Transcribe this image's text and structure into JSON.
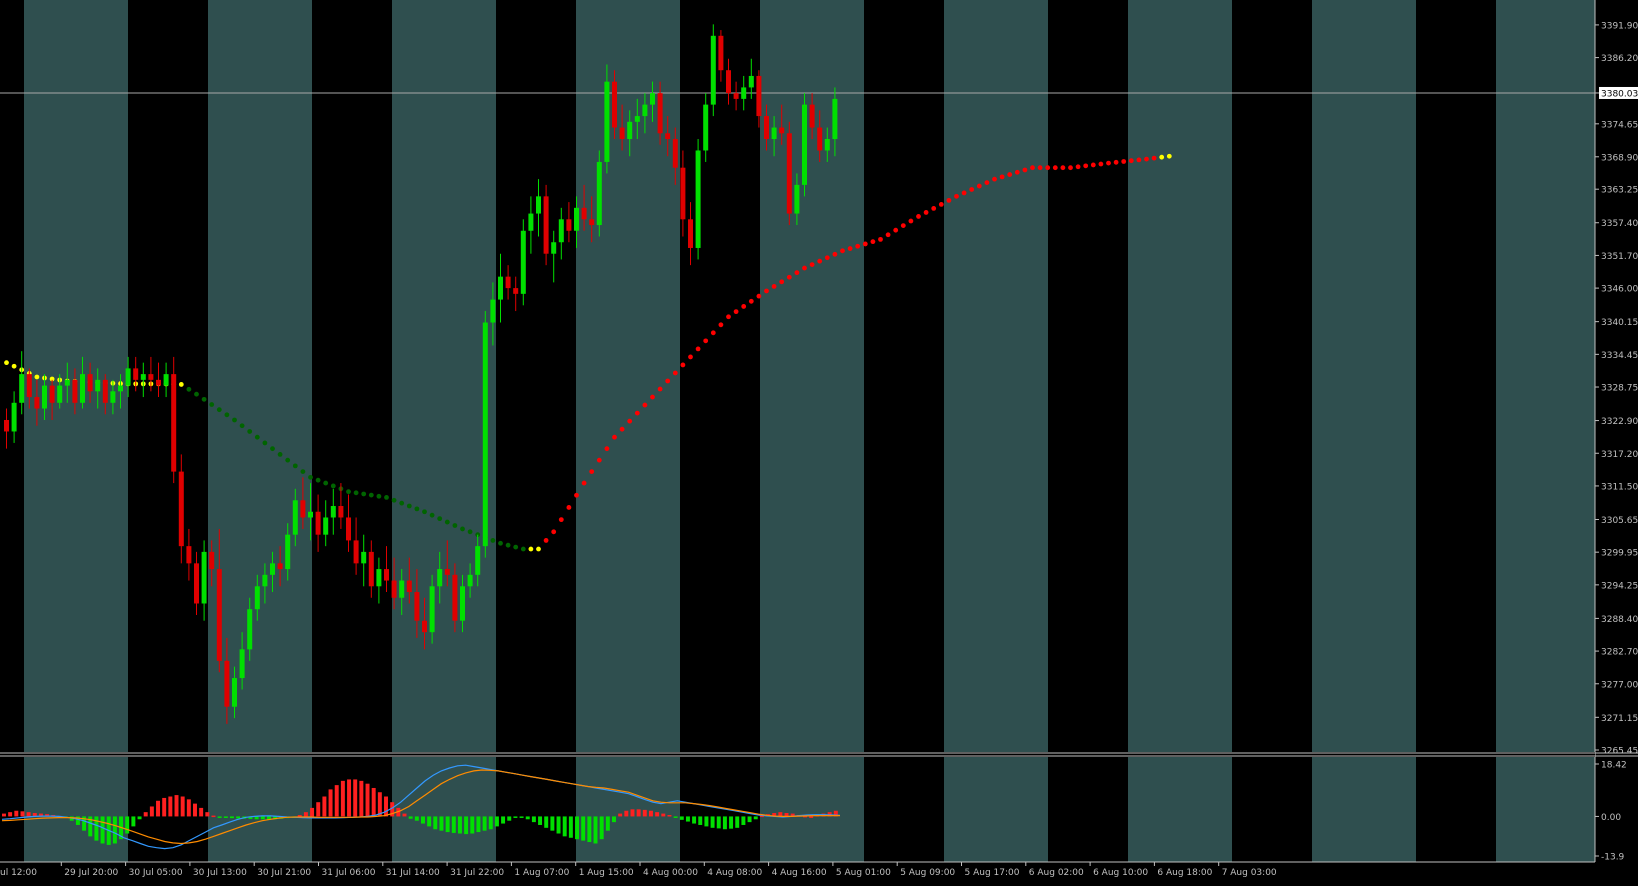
{
  "chart_data": [
    {
      "type": "candlestick",
      "title": "",
      "y_axis_ticks": [
        "3391.90",
        "3386.20",
        "3380.03",
        "3374.65",
        "3368.90",
        "3363.25",
        "3357.40",
        "3351.70",
        "3346.00",
        "3340.15",
        "3334.45",
        "3328.75",
        "3322.90",
        "3317.20",
        "3311.50",
        "3305.65",
        "3299.95",
        "3294.25",
        "3288.40",
        "3282.70",
        "3277.00",
        "3271.15",
        "3265.45"
      ],
      "ylim": [
        3265.45,
        3395.5
      ],
      "current_price": 3380.03,
      "x_axis_labels": [
        "ul 12:00",
        "29 Jul 20:00",
        "30 Jul 05:00",
        "30 Jul 13:00",
        "30 Jul 21:00",
        "31 Jul 06:00",
        "31 Jul 14:00",
        "31 Jul 22:00",
        "1 Aug 07:00",
        "1 Aug 15:00",
        "4 Aug 00:00",
        "4 Aug 08:00",
        "4 Aug 16:00",
        "5 Aug 01:00",
        "5 Aug 09:00",
        "5 Aug 17:00",
        "6 Aug 02:00",
        "6 Aug 10:00",
        "6 Aug 18:00",
        "7 Aug 03:00"
      ],
      "colors": {
        "bull": "#00e000",
        "bear": "#e00000",
        "background_light": "#2f4f4f",
        "background_dark": "#000000",
        "ma_yellow": "#ffff00",
        "ma_green": "#006400",
        "ma_red": "#ff0000"
      },
      "moving_average": [
        {
          "x": 0,
          "y": 3333.0,
          "c": "yellow"
        },
        {
          "x": 4,
          "y": 3330.5,
          "c": "yellow"
        },
        {
          "x": 8,
          "y": 3329.8,
          "c": "yellow"
        },
        {
          "x": 12,
          "y": 3329.5,
          "c": "yellow"
        },
        {
          "x": 16,
          "y": 3329.3,
          "c": "yellow"
        },
        {
          "x": 20,
          "y": 3329.3,
          "c": "yellow"
        },
        {
          "x": 23,
          "y": 3329.2,
          "c": "yellow"
        },
        {
          "x": 25,
          "y": 3327.5,
          "c": "green"
        },
        {
          "x": 30,
          "y": 3323.0,
          "c": "green"
        },
        {
          "x": 35,
          "y": 3318.0,
          "c": "green"
        },
        {
          "x": 40,
          "y": 3313.0,
          "c": "green"
        },
        {
          "x": 45,
          "y": 3310.5,
          "c": "green"
        },
        {
          "x": 50,
          "y": 3309.5,
          "c": "green"
        },
        {
          "x": 55,
          "y": 3307.0,
          "c": "green"
        },
        {
          "x": 60,
          "y": 3304.0,
          "c": "green"
        },
        {
          "x": 65,
          "y": 3301.5,
          "c": "green"
        },
        {
          "x": 68,
          "y": 3300.5,
          "c": "green"
        },
        {
          "x": 70,
          "y": 3300.5,
          "c": "yellow"
        },
        {
          "x": 72,
          "y": 3303.5,
          "c": "red"
        },
        {
          "x": 76,
          "y": 3312.0,
          "c": "red"
        },
        {
          "x": 80,
          "y": 3320.0,
          "c": "red"
        },
        {
          "x": 85,
          "y": 3327.0,
          "c": "red"
        },
        {
          "x": 90,
          "y": 3334.0,
          "c": "red"
        },
        {
          "x": 95,
          "y": 3341.0,
          "c": "red"
        },
        {
          "x": 100,
          "y": 3345.5,
          "c": "red"
        },
        {
          "x": 105,
          "y": 3349.5,
          "c": "red"
        },
        {
          "x": 110,
          "y": 3352.5,
          "c": "red"
        },
        {
          "x": 115,
          "y": 3354.5,
          "c": "red"
        },
        {
          "x": 120,
          "y": 3358.5,
          "c": "red"
        },
        {
          "x": 125,
          "y": 3362.0,
          "c": "red"
        },
        {
          "x": 130,
          "y": 3365.0,
          "c": "red"
        },
        {
          "x": 135,
          "y": 3367.0,
          "c": "red"
        },
        {
          "x": 140,
          "y": 3367.0,
          "c": "red"
        },
        {
          "x": 145,
          "y": 3367.8,
          "c": "red"
        },
        {
          "x": 150,
          "y": 3368.5,
          "c": "red"
        },
        {
          "x": 153,
          "y": 3369.0,
          "c": "yellow"
        }
      ],
      "candles": [
        [
          3323,
          3325,
          3318,
          3321
        ],
        [
          3321,
          3328,
          3319,
          3326
        ],
        [
          3326,
          3335,
          3324,
          3331
        ],
        [
          3331,
          3332,
          3325,
          3327
        ],
        [
          3327,
          3330,
          3322,
          3325
        ],
        [
          3325,
          3331,
          3323,
          3329
        ],
        [
          3329,
          3330,
          3323,
          3326
        ],
        [
          3326,
          3331,
          3325,
          3329
        ],
        [
          3329,
          3333,
          3326,
          3330
        ],
        [
          3330,
          3332,
          3324,
          3326
        ],
        [
          3326,
          3334,
          3325,
          3331
        ],
        [
          3331,
          3333,
          3326,
          3328
        ],
        [
          3328,
          3332,
          3325,
          3330
        ],
        [
          3330,
          3331,
          3324,
          3326
        ],
        [
          3326,
          3330,
          3324,
          3328
        ],
        [
          3328,
          3331,
          3325,
          3329
        ],
        [
          3329,
          3334,
          3327,
          3332
        ],
        [
          3332,
          3334,
          3328,
          3330
        ],
        [
          3330,
          3333,
          3327,
          3331
        ],
        [
          3331,
          3334,
          3328,
          3330
        ],
        [
          3330,
          3333,
          3327,
          3329
        ],
        [
          3329,
          3333,
          3327,
          3331
        ],
        [
          3331,
          3334,
          3312,
          3314
        ],
        [
          3314,
          3317,
          3298,
          3301
        ],
        [
          3301,
          3304,
          3295,
          3298
        ],
        [
          3298,
          3300,
          3289,
          3291
        ],
        [
          3291,
          3302,
          3288,
          3300
        ],
        [
          3300,
          3302,
          3294,
          3297
        ],
        [
          3297,
          3304,
          3279,
          3281
        ],
        [
          3281,
          3285,
          3270,
          3273
        ],
        [
          3273,
          3280,
          3271,
          3278
        ],
        [
          3278,
          3286,
          3276,
          3283
        ],
        [
          3283,
          3292,
          3281,
          3290
        ],
        [
          3290,
          3296,
          3288,
          3294
        ],
        [
          3294,
          3298,
          3291,
          3296
        ],
        [
          3296,
          3300,
          3293,
          3298
        ],
        [
          3298,
          3301,
          3294,
          3297
        ],
        [
          3297,
          3305,
          3295,
          3303
        ],
        [
          3303,
          3311,
          3301,
          3309
        ],
        [
          3309,
          3313,
          3304,
          3306
        ],
        [
          3306,
          3312,
          3302,
          3307
        ],
        [
          3307,
          3310,
          3300,
          3303
        ],
        [
          3303,
          3309,
          3301,
          3306
        ],
        [
          3306,
          3311,
          3303,
          3308
        ],
        [
          3308,
          3312,
          3304,
          3306
        ],
        [
          3306,
          3310,
          3300,
          3302
        ],
        [
          3302,
          3306,
          3296,
          3298
        ],
        [
          3298,
          3303,
          3294,
          3300
        ],
        [
          3300,
          3302,
          3292,
          3294
        ],
        [
          3294,
          3299,
          3291,
          3297
        ],
        [
          3297,
          3301,
          3293,
          3295
        ],
        [
          3295,
          3299,
          3290,
          3292
        ],
        [
          3292,
          3297,
          3289,
          3295
        ],
        [
          3295,
          3299,
          3291,
          3293
        ],
        [
          3293,
          3297,
          3285,
          3288
        ],
        [
          3288,
          3292,
          3283,
          3286
        ],
        [
          3286,
          3296,
          3284,
          3294
        ],
        [
          3294,
          3300,
          3291,
          3297
        ],
        [
          3297,
          3302,
          3294,
          3296
        ],
        [
          3296,
          3298,
          3286,
          3288
        ],
        [
          3288,
          3296,
          3286,
          3294
        ],
        [
          3294,
          3298,
          3292,
          3296
        ],
        [
          3296,
          3303,
          3294,
          3301
        ],
        [
          3301,
          3342,
          3299,
          3340
        ],
        [
          3340,
          3347,
          3336,
          3344
        ],
        [
          3344,
          3352,
          3340,
          3348
        ],
        [
          3348,
          3350,
          3344,
          3346
        ],
        [
          3346,
          3348,
          3342,
          3345
        ],
        [
          3345,
          3358,
          3343,
          3356
        ],
        [
          3356,
          3362,
          3352,
          3359
        ],
        [
          3359,
          3365,
          3355,
          3362
        ],
        [
          3362,
          3364,
          3350,
          3352
        ],
        [
          3352,
          3356,
          3347,
          3354
        ],
        [
          3354,
          3360,
          3351,
          3358
        ],
        [
          3358,
          3361,
          3354,
          3356
        ],
        [
          3356,
          3362,
          3353,
          3360
        ],
        [
          3360,
          3364,
          3356,
          3358
        ],
        [
          3358,
          3362,
          3354,
          3357
        ],
        [
          3357,
          3370,
          3355,
          3368
        ],
        [
          3368,
          3385,
          3366,
          3382
        ],
        [
          3382,
          3384,
          3372,
          3374
        ],
        [
          3374,
          3378,
          3370,
          3372
        ],
        [
          3372,
          3377,
          3369,
          3375
        ],
        [
          3375,
          3379,
          3372,
          3376
        ],
        [
          3376,
          3380,
          3373,
          3378
        ],
        [
          3378,
          3382,
          3375,
          3380
        ],
        [
          3380,
          3382,
          3371,
          3373
        ],
        [
          3373,
          3376,
          3369,
          3372
        ],
        [
          3372,
          3374,
          3364,
          3367
        ],
        [
          3367,
          3370,
          3355,
          3358
        ],
        [
          3358,
          3361,
          3350,
          3353
        ],
        [
          3353,
          3372,
          3351,
          3370
        ],
        [
          3370,
          3380,
          3368,
          3378
        ],
        [
          3378,
          3392,
          3376,
          3390
        ],
        [
          3390,
          3391,
          3382,
          3384
        ],
        [
          3384,
          3386,
          3378,
          3380
        ],
        [
          3380,
          3382,
          3377,
          3379
        ],
        [
          3379,
          3383,
          3377,
          3381
        ],
        [
          3381,
          3386,
          3379,
          3383
        ],
        [
          3383,
          3384,
          3374,
          3376
        ],
        [
          3376,
          3378,
          3370,
          3372
        ],
        [
          3372,
          3376,
          3369,
          3374
        ],
        [
          3374,
          3378,
          3371,
          3373
        ],
        [
          3373,
          3375,
          3357,
          3359
        ],
        [
          3359,
          3366,
          3357,
          3364
        ],
        [
          3364,
          3380,
          3362,
          3378
        ],
        [
          3378,
          3380,
          3372,
          3374
        ],
        [
          3374,
          3377,
          3368,
          3370
        ],
        [
          3370,
          3374,
          3368,
          3372
        ],
        [
          3372,
          3381,
          3369,
          3379
        ]
      ]
    },
    {
      "type": "histogram",
      "title": "",
      "y_axis_ticks": [
        "18.42",
        "0.00",
        "-13.9"
      ],
      "ylim": [
        -13.9,
        18.42
      ],
      "colors": {
        "positive": "#ff2020",
        "negative": "#00e000",
        "line_blue": "#3399ff",
        "line_orange": "#ff8c00"
      },
      "histogram": [
        1,
        1.5,
        2,
        1.8,
        1.5,
        1.2,
        1,
        0.8,
        0.5,
        0.2,
        -0.5,
        -1.5,
        -3,
        -5,
        -7,
        -8.5,
        -9.5,
        -10,
        -9.5,
        -8,
        -6,
        -3.5,
        -1,
        1.5,
        3.5,
        5.5,
        6.5,
        7,
        7.5,
        7,
        6,
        4.5,
        3,
        1.5,
        0.3,
        -0.3,
        -0.5,
        -0.6,
        -0.7,
        -0.8,
        -0.9,
        -1,
        -1,
        -1.1,
        -1,
        -0.8,
        -0.6,
        -0.3,
        0.5,
        1.5,
        3,
        5,
        7,
        9.5,
        11,
        12.5,
        13,
        13,
        12.5,
        11.5,
        10,
        8.5,
        7,
        5,
        3,
        1,
        -0.8,
        -1.5,
        -2.5,
        -3.5,
        -4.5,
        -5,
        -5.5,
        -5.8,
        -6,
        -6.2,
        -6,
        -5.5,
        -5,
        -4.5,
        -3.5,
        -2.5,
        -1.5,
        -0.5,
        -0.3,
        -1,
        -2,
        -3,
        -4,
        -5,
        -6,
        -7,
        -7.5,
        -8,
        -8.5,
        -9,
        -9.5,
        -8,
        -5,
        -2,
        1,
        2,
        2.5,
        2.5,
        2.3,
        2,
        1.5,
        1,
        0.5,
        -0.5,
        -1.2,
        -1.8,
        -2.5,
        -3,
        -3.5,
        -4,
        -4.2,
        -4.5,
        -4.3,
        -4,
        -3,
        -2,
        -1,
        0.3,
        0.8,
        1.2,
        1.5,
        1.2,
        1,
        0.5,
        0.2,
        0,
        0.5,
        1,
        1.5,
        2
      ],
      "line_blue": [
        -1,
        -0.8,
        -0.5,
        -0.2,
        0,
        0.1,
        0.1,
        0,
        -0.3,
        -0.8,
        -1.5,
        -2.5,
        -3.5,
        -4.8,
        -6,
        -7.5,
        -8.5,
        -9.5,
        -10.5,
        -11,
        -11.3,
        -11,
        -10,
        -8.5,
        -7,
        -5.5,
        -4,
        -3,
        -2,
        -1,
        -0.3,
        0,
        0.2,
        0.2,
        0,
        -0.2,
        -0.3,
        -0.4,
        -0.5,
        -0.5,
        -0.5,
        -0.5,
        -0.4,
        -0.3,
        -0.2,
        0,
        0.5,
        1.5,
        3,
        5,
        7.5,
        10,
        12.5,
        14.5,
        16,
        17,
        17.8,
        18,
        17.5,
        17,
        16.5,
        16,
        15.5,
        15,
        14.5,
        14,
        13.5,
        13,
        12.5,
        12,
        11.5,
        11,
        10.5,
        10,
        9.5,
        9,
        8.5,
        8,
        7,
        6,
        5,
        4.5,
        5,
        5.5,
        5,
        4.5,
        4,
        3.5,
        3,
        2.5,
        2,
        1.5,
        1,
        0.5,
        0.2,
        0,
        -0.2,
        0,
        0.3,
        0.5,
        0.6,
        0.6,
        0.5,
        0.4
      ],
      "line_orange": [
        -1.5,
        -1.4,
        -1.2,
        -1,
        -0.8,
        -0.6,
        -0.5,
        -0.4,
        -0.4,
        -0.5,
        -0.8,
        -1.2,
        -1.8,
        -2.5,
        -3.3,
        -4.2,
        -5.2,
        -6.2,
        -7.2,
        -8,
        -8.8,
        -9.3,
        -9.5,
        -9.3,
        -8.8,
        -8,
        -7,
        -6,
        -5,
        -4,
        -3,
        -2.2,
        -1.5,
        -1,
        -0.6,
        -0.3,
        -0.2,
        -0.2,
        -0.2,
        -0.3,
        -0.3,
        -0.3,
        -0.3,
        -0.3,
        -0.2,
        -0.2,
        0,
        0.3,
        1,
        2,
        3.5,
        5.5,
        7.5,
        9.5,
        11.5,
        13,
        14.3,
        15.3,
        16,
        16.3,
        16.2,
        16,
        15.5,
        15,
        14.5,
        14,
        13.5,
        13,
        12.5,
        12,
        11.5,
        11,
        10.5,
        10.2,
        10,
        9.5,
        9,
        8.5,
        7.5,
        6.5,
        5.5,
        5,
        4.8,
        4.8,
        4.8,
        4.5,
        4.2,
        3.8,
        3.3,
        2.8,
        2.3,
        1.8,
        1.3,
        0.8,
        0.4,
        0.1,
        0,
        0,
        0.1,
        0.2,
        0.3,
        0.3,
        0.3,
        0.3
      ]
    }
  ]
}
